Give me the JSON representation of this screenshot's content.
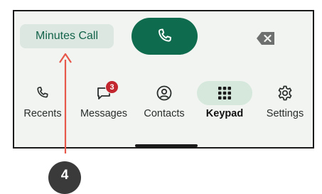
{
  "top": {
    "minutes_call_label": "Minutes Call"
  },
  "nav": {
    "items": [
      {
        "label": "Recents",
        "icon": "phone-handset-icon"
      },
      {
        "label": "Messages",
        "icon": "message-icon",
        "badge": "3"
      },
      {
        "label": "Contacts",
        "icon": "person-circle-icon"
      },
      {
        "label": "Keypad",
        "icon": "dialpad-icon",
        "active": true
      },
      {
        "label": "Settings",
        "icon": "gear-icon"
      }
    ]
  },
  "annotation": {
    "step_number": "4"
  },
  "colors": {
    "accent": "#0f6b4d",
    "chip_bg": "#dbe7e0",
    "active_pill": "#d6e8dc",
    "badge": "#c2262e",
    "annotation_arrow": "#e8584a",
    "step_circle": "#3a3a3a"
  }
}
